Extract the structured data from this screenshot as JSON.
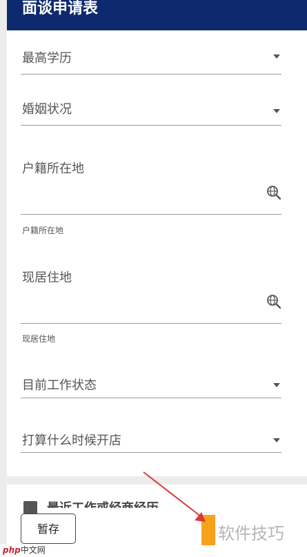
{
  "header": {
    "title": "面谈申请表"
  },
  "fields": {
    "education": {
      "label": "最高学历",
      "icon": "caret-down-icon"
    },
    "marital": {
      "label": "婚姻状况",
      "icon": "caret-down-icon"
    },
    "hukou": {
      "label": "户籍所在地",
      "hint": "户籍所在地",
      "icon": "search-globe-icon"
    },
    "residence": {
      "label": "现居住地",
      "hint": "现居住地",
      "icon": "search-globe-icon"
    },
    "work_status": {
      "label": "目前工作状态",
      "icon": "caret-down-icon"
    },
    "open_plan": {
      "label": "打算什么时候开店",
      "icon": "caret-down-icon"
    }
  },
  "section": {
    "title": "最近工作或经商经历"
  },
  "actions": {
    "save_label": "暂存"
  },
  "watermarks": {
    "right": "软件技巧",
    "left_brand": "php",
    "left_text": "中文网"
  },
  "colors": {
    "header_bg": "#0d2a6e",
    "accent_orange": "#f7a21b",
    "arrow": "#d93a36"
  }
}
